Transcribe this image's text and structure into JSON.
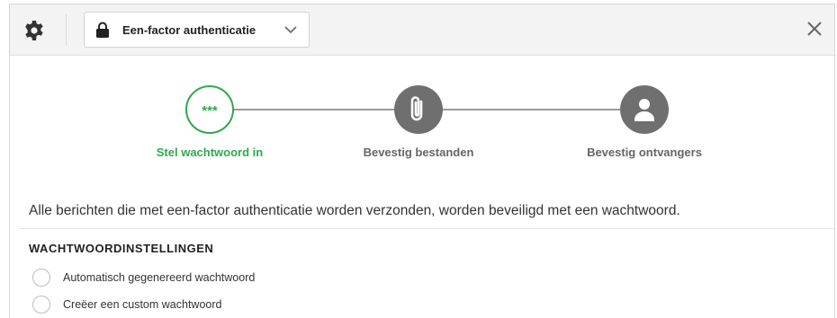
{
  "toolbar": {
    "mode_label": "Een-factor authenticatie",
    "icons": {
      "settings": "gear-icon",
      "mode": "lock-icon",
      "dropdown": "chevron-down-icon",
      "close": "close-icon"
    }
  },
  "steps": [
    {
      "label": "Stel wachtwoord in",
      "state": "active",
      "icon": "password-dots-icon",
      "icon_text": "***"
    },
    {
      "label": "Bevestig bestanden",
      "state": "inactive",
      "icon": "paperclip-icon"
    },
    {
      "label": "Bevestig ontvangers",
      "state": "inactive",
      "icon": "user-icon"
    }
  ],
  "colors": {
    "accent": "#2fa84f",
    "inactive_step": "#6f6f6f",
    "line": "#9a9a9a"
  },
  "description": "Alle berichten die met een-factor authenticatie worden verzonden, worden beveiligd met een wachtwoord.",
  "password_settings": {
    "title": "WACHTWOORDINSTELLINGEN",
    "options": [
      {
        "label": "Automatisch gegenereerd wachtwoord",
        "selected": false
      },
      {
        "label": "Creëer een custom wachtwoord",
        "selected": false
      }
    ]
  }
}
